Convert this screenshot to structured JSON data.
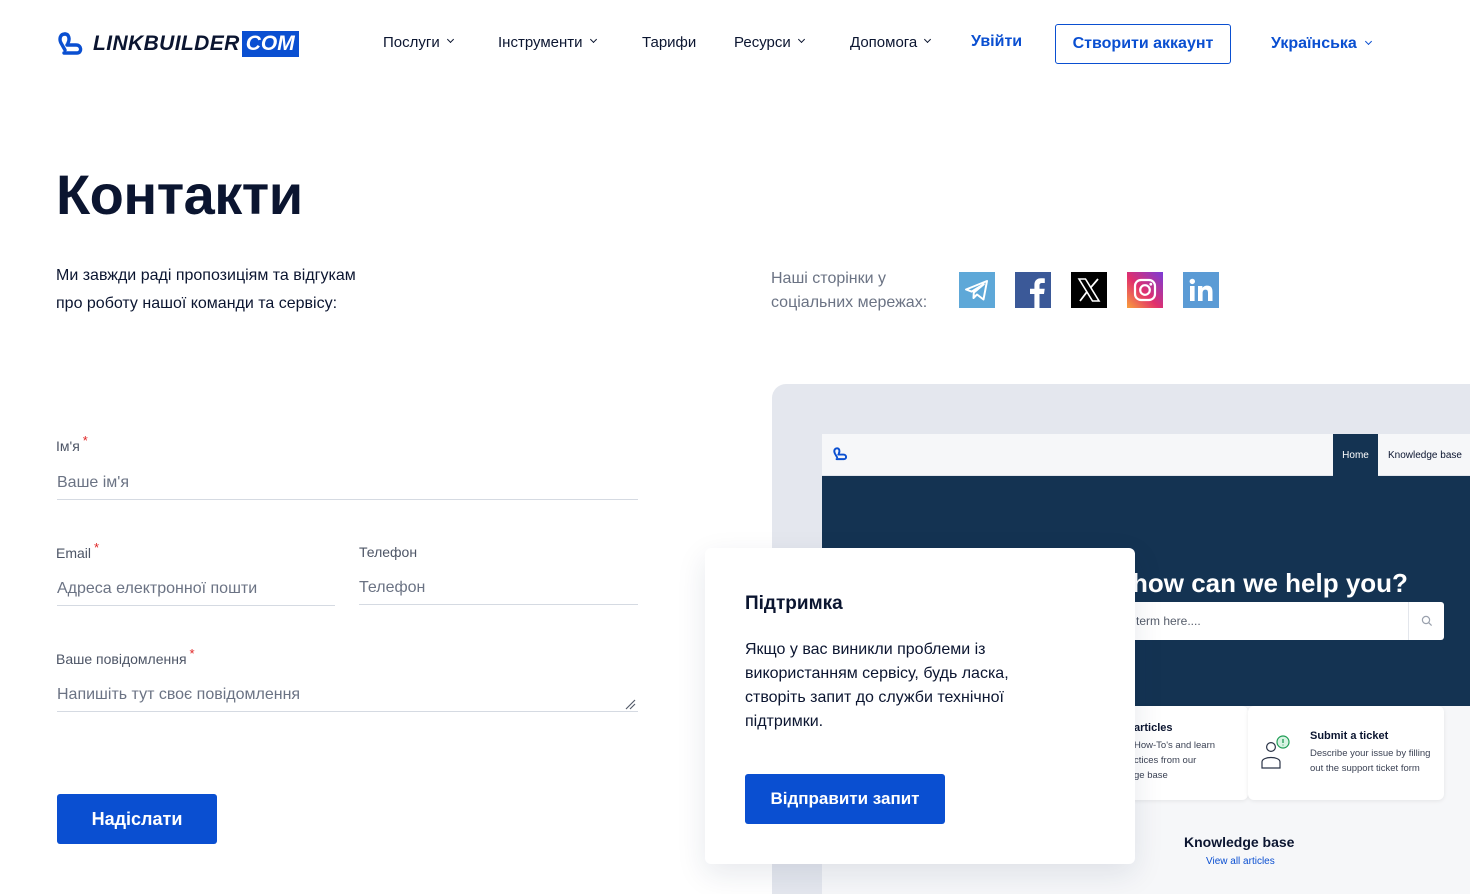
{
  "header": {
    "logo_text": "LINKBUILDER",
    "logo_tld": "COM",
    "nav": [
      {
        "label": "Послуги"
      },
      {
        "label": "Інструменти"
      },
      {
        "label": "Тарифи"
      },
      {
        "label": "Ресурси"
      },
      {
        "label": "Допомога"
      }
    ],
    "login_label": "Увійти",
    "signup_label": "Створити аккаунт",
    "language_label": "Українська"
  },
  "page": {
    "title": "Контакти",
    "intro_line1": "Ми завжди раді пропозиціям та відгукам",
    "intro_line2": "про роботу нашої команди та сервісу:"
  },
  "social": {
    "label_line1": "Наші сторінки у",
    "label_line2": "соціальних мережах:",
    "networks": [
      "telegram-icon",
      "facebook-icon",
      "x-icon",
      "instagram-icon",
      "linkedin-icon"
    ]
  },
  "form": {
    "name_label": "Ім'я",
    "name_placeholder": "Ваше ім'я",
    "email_label": "Email",
    "email_placeholder": "Адреса електронної пошти",
    "phone_label": "Телефон",
    "phone_placeholder": "Телефон",
    "message_label": "Ваше повідомлення",
    "message_placeholder": "Напишіть тут своє повідомлення",
    "required_mark": "*",
    "submit_label": "Надіслати"
  },
  "preview": {
    "tab_home": "Home",
    "tab_knowledge_base": "Knowledge base",
    "heading": "how can we help you?",
    "search_placeholder": "term here....",
    "card1_title": "articles",
    "card1_line1": "How-To's and learn",
    "card1_line2": "ctices from our",
    "card1_line3": "ge base",
    "card2_title": "Submit a ticket",
    "card2_line1": "Describe your issue by filling",
    "card2_line2": "out the support ticket form",
    "kb_title": "Knowledge base",
    "kb_link": "View all articles"
  },
  "support": {
    "title": "Підтримка",
    "line1": "Якщо у вас виникли проблеми із",
    "line2": "використанням сервісу, будь ласка,",
    "line3": "створіть запит до служби технічної",
    "line4": "підтримки.",
    "button_label": "Відправити запит"
  },
  "colors": {
    "brand_blue": "#0a4fd1",
    "dark_text": "#0b1530",
    "preview_navy": "#143352",
    "required_red": "#e02424"
  }
}
